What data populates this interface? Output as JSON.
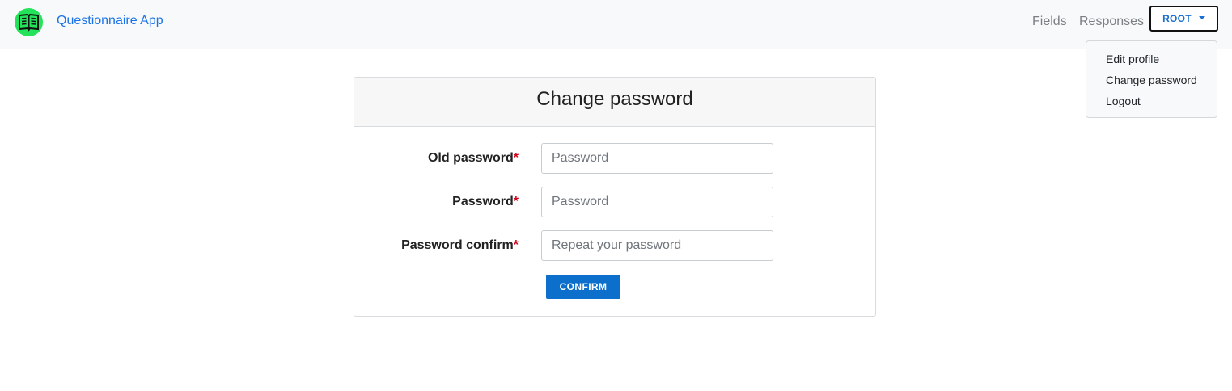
{
  "app": {
    "brand": "Questionnaire App",
    "logo_icon": "open-book-icon",
    "accent_color": "#22e35a"
  },
  "nav": {
    "fields": "Fields",
    "responses": "Responses",
    "user_button": "ROOT"
  },
  "user_menu": {
    "items": [
      "Edit profile",
      "Change password",
      "Logout"
    ]
  },
  "form": {
    "title": "Change password",
    "required_mark": "*",
    "fields": [
      {
        "label": "Old password",
        "placeholder": "Password",
        "value": ""
      },
      {
        "label": "Password",
        "placeholder": "Password",
        "value": ""
      },
      {
        "label": "Password confirm",
        "placeholder": "Repeat your password",
        "value": ""
      }
    ],
    "submit_label": "CONFIRM",
    "submit_color": "#0b6fcb"
  }
}
